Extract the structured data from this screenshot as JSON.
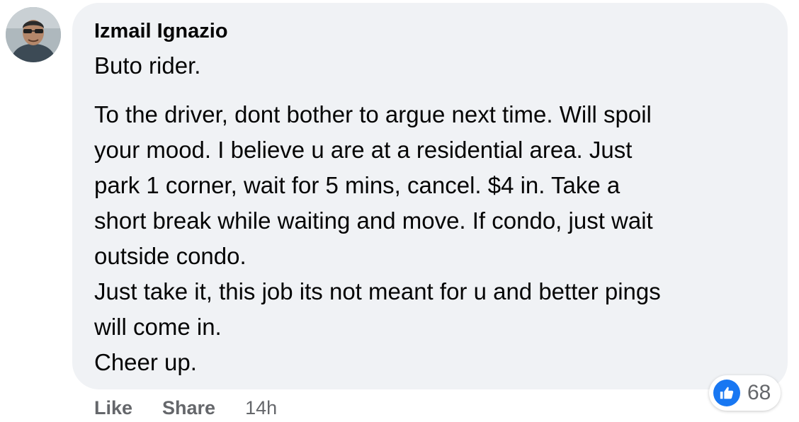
{
  "comment": {
    "author": "Izmail Ignazio",
    "paragraphs": [
      [
        "Buto rider."
      ],
      [
        "To the driver, dont bother to argue next time. Will spoil",
        "your mood. I believe u are at a residential area. Just",
        "park 1 corner, wait for 5 mins, cancel. $4 in. Take a",
        "short break while waiting and move. If condo, just wait",
        "outside condo.",
        "Just take it, this job its not meant for u and better pings",
        "will come in.",
        "Cheer up."
      ]
    ],
    "actions": {
      "like_label": "Like",
      "share_label": "Share",
      "timestamp": "14h"
    },
    "reactions": {
      "icon": "thumbs-up-icon",
      "count": "68"
    }
  },
  "colors": {
    "bubble_background": "#f0f2f5",
    "secondary_text": "#65676b",
    "like_blue": "#1877f2"
  }
}
